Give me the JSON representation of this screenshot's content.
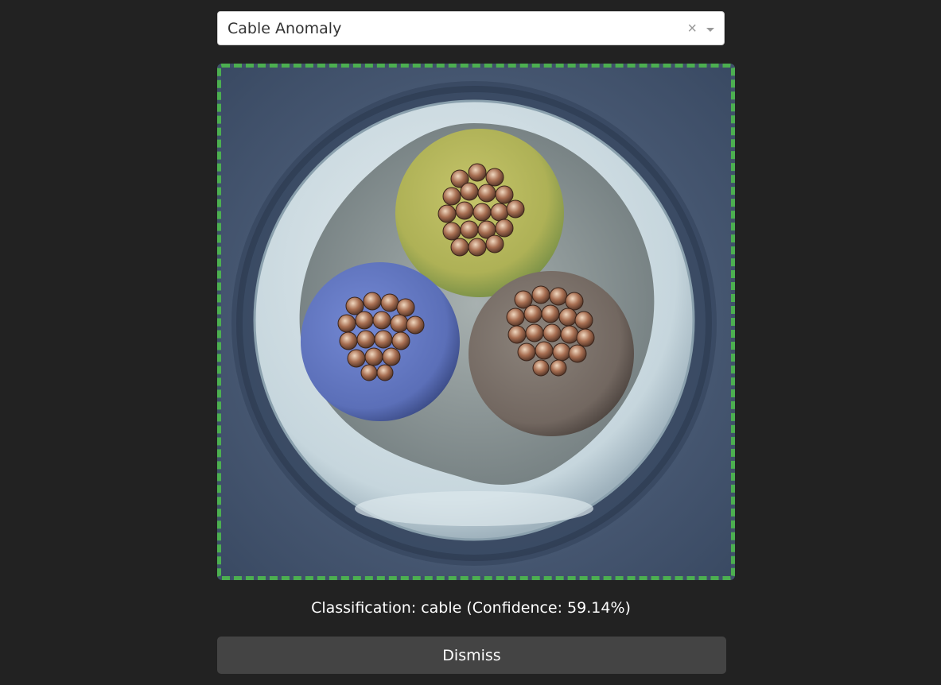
{
  "select": {
    "value": "Cable Anomaly",
    "clear_glyph": "×",
    "clear_icon": "close-icon",
    "arrow_icon": "chevron-down-icon"
  },
  "image": {
    "subject": "cable cross-section with three conductors",
    "conductors": [
      "green-yellow",
      "blue",
      "brown"
    ],
    "frame_color": "#4caf50"
  },
  "result": {
    "caption": "Classification: cable (Confidence: 59.14%)"
  },
  "actions": {
    "dismiss_label": "Dismiss"
  }
}
